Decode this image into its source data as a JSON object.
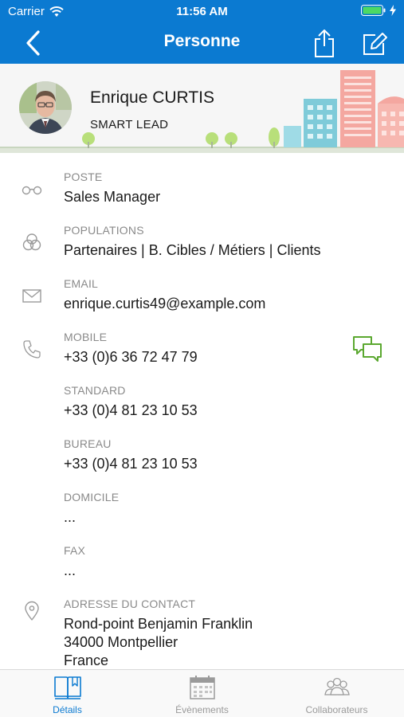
{
  "status_bar": {
    "carrier": "Carrier",
    "time": "11:56 AM"
  },
  "nav": {
    "title": "Personne",
    "back_icon": "chevron-left-icon",
    "share_icon": "share-icon",
    "edit_icon": "edit-icon"
  },
  "person": {
    "name": "Enrique CURTIS",
    "tag": "SMART LEAD"
  },
  "details": [
    {
      "label": "POSTE",
      "value": "Sales Manager",
      "icon": "glasses-icon"
    },
    {
      "label": "POPULATIONS",
      "value": "Partenaires | B. Cibles / Métiers | Clients",
      "icon": "circles-icon"
    },
    {
      "label": "EMAIL",
      "value": "enrique.curtis49@example.com",
      "icon": "mail-icon"
    },
    {
      "label": "MOBILE",
      "value": "+33 (0)6 36 72 47 79",
      "icon": "phone-icon",
      "action_icon": "chat-icon"
    },
    {
      "label": "STANDARD",
      "value": "+33 (0)4 81 23 10 53"
    },
    {
      "label": "BUREAU",
      "value": "+33 (0)4 81 23 10 53"
    },
    {
      "label": "DOMICILE",
      "value": "..."
    },
    {
      "label": "FAX",
      "value": "..."
    },
    {
      "label": "ADRESSE DU CONTACT",
      "value_lines": [
        "Rond-point Benjamin Franklin",
        "34000 Montpellier",
        "France"
      ],
      "icon": "location-pin-icon"
    }
  ],
  "tabs": [
    {
      "label": "Détails",
      "icon": "book-icon",
      "active": true
    },
    {
      "label": "Évènements",
      "icon": "calendar-icon",
      "active": false
    },
    {
      "label": "Collaborateurs",
      "icon": "people-icon",
      "active": false
    }
  ],
  "colors": {
    "brand_blue": "#0b7ad1",
    "accent_green": "#5ba830",
    "label_gray": "#8a8a8a"
  }
}
